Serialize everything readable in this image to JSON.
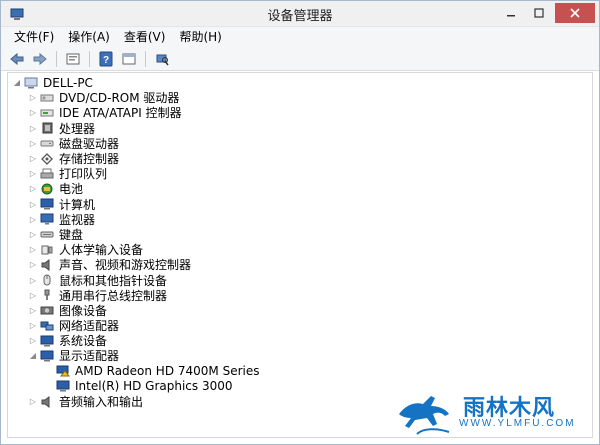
{
  "window": {
    "title": "设备管理器"
  },
  "menu": [
    "文件(F)",
    "操作(A)",
    "查看(V)",
    "帮助(H)"
  ],
  "toolbar": [
    {
      "icon": "back-arrow-icon"
    },
    {
      "icon": "forward-arrow-icon"
    },
    {
      "icon": "properties-icon"
    },
    {
      "icon": "refresh-icon"
    },
    {
      "icon": "help-icon"
    },
    {
      "icon": "view-icon"
    },
    {
      "icon": "scan-hardware-icon"
    }
  ],
  "tree": {
    "root": "DELL-PC",
    "items": [
      "DVD/CD-ROM 驱动器",
      "IDE ATA/ATAPI 控制器",
      "处理器",
      "磁盘驱动器",
      "存储控制器",
      "打印队列",
      "电池",
      "计算机",
      "监视器",
      "键盘",
      "人体学输入设备",
      "声音、视频和游戏控制器",
      "鼠标和其他指针设备",
      "通用串行总线控制器",
      "图像设备",
      "网络适配器",
      "系统设备",
      "显示适配器"
    ],
    "display_children": [
      "AMD Radeon HD 7400M Series",
      "Intel(R) HD Graphics 3000"
    ],
    "last": "音频输入和输出"
  },
  "watermark": {
    "text": "雨林木风",
    "url": "WWW.YLMFU.COM",
    "accent": "#1573c4"
  }
}
